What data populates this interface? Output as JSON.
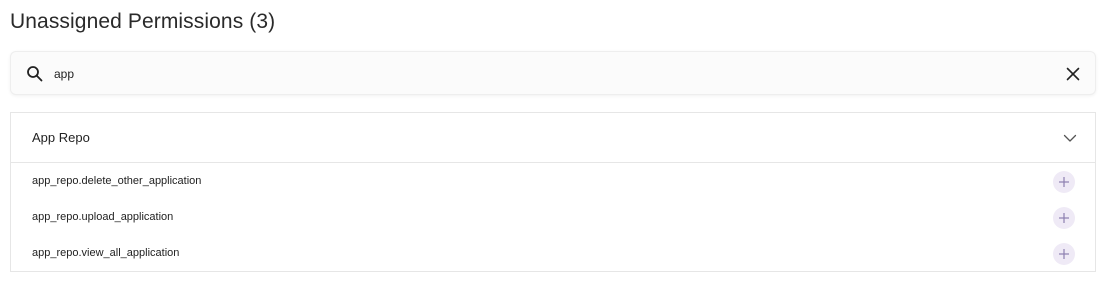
{
  "header": {
    "title": "Unassigned Permissions (3)"
  },
  "search": {
    "value": "app",
    "placeholder": "",
    "icon": "search-icon",
    "clear_icon": "close-icon"
  },
  "group": {
    "title": "App Repo",
    "expanded": true,
    "chevron_icon": "chevron-down-icon",
    "items": [
      {
        "label": "app_repo.delete_other_application",
        "action_icon": "plus-icon"
      },
      {
        "label": "app_repo.upload_application",
        "action_icon": "plus-icon"
      },
      {
        "label": "app_repo.view_all_application",
        "action_icon": "plus-icon"
      }
    ]
  },
  "colors": {
    "add_button_bg": "#efeaf6",
    "add_icon": "#8c7fb0",
    "border": "#e6e6e6"
  }
}
